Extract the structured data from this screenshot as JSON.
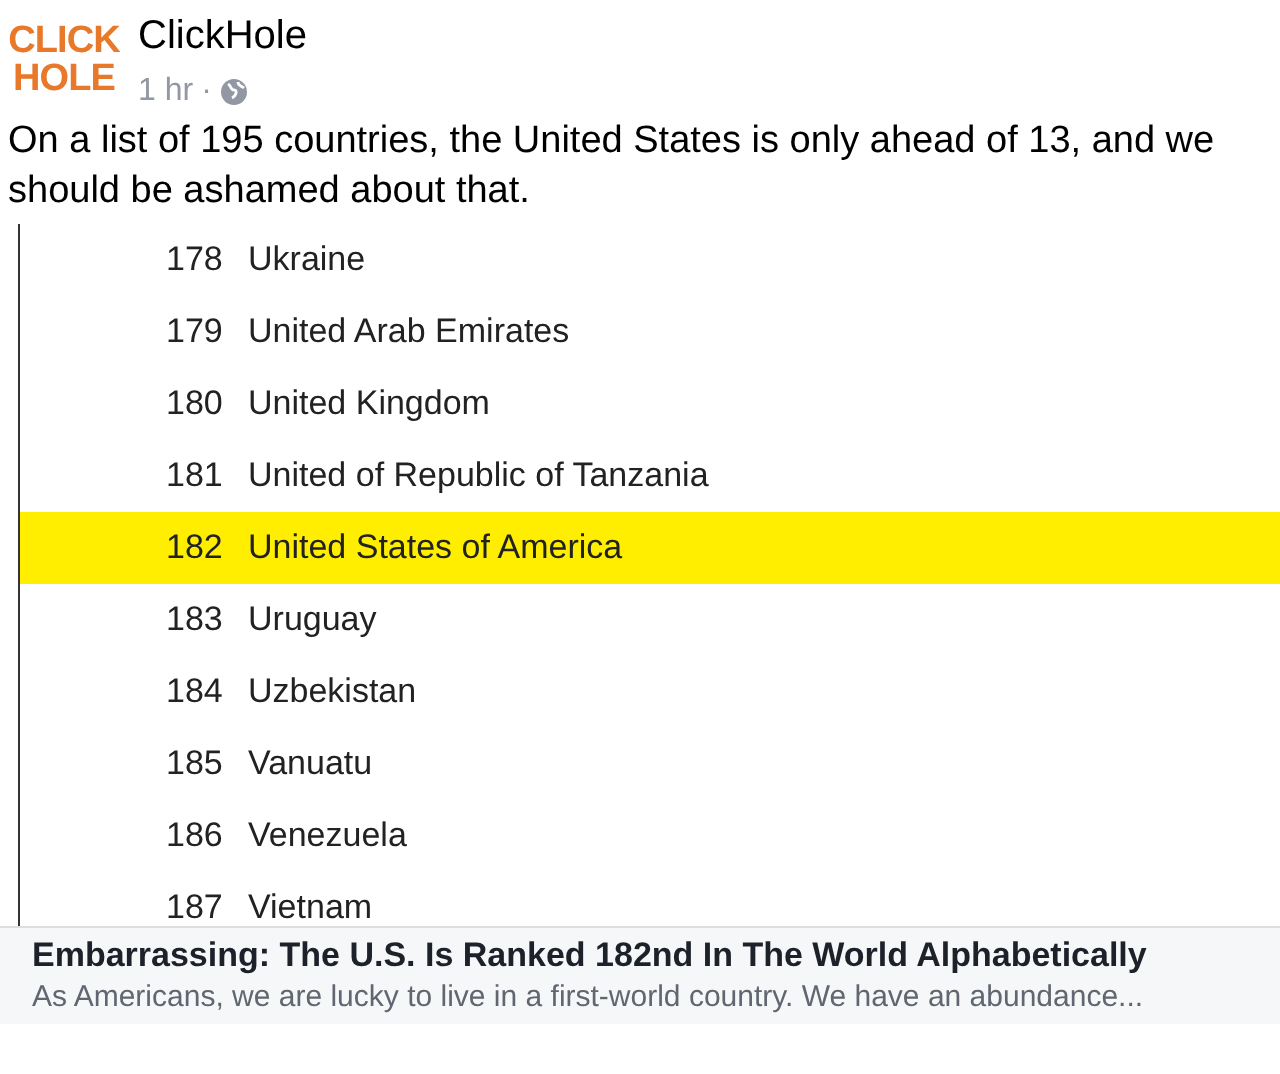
{
  "post": {
    "page_name": "ClickHole",
    "logo_line_1": "CLICK",
    "logo_line_2": "HOLE",
    "time": "1 hr",
    "separator": "·",
    "text": "On a list of 195 countries, the United States is only ahead of 13, and we should be ashamed about that."
  },
  "list": [
    {
      "rank": "178",
      "country": "Ukraine",
      "selected": false
    },
    {
      "rank": "179",
      "country": "United Arab Emirates",
      "selected": false
    },
    {
      "rank": "180",
      "country": "United Kingdom",
      "selected": false
    },
    {
      "rank": "181",
      "country": "United of Republic of Tanzania",
      "selected": false
    },
    {
      "rank": "182",
      "country": "United States of America",
      "selected": true
    },
    {
      "rank": "183",
      "country": "Uruguay",
      "selected": false
    },
    {
      "rank": "184",
      "country": "Uzbekistan",
      "selected": false
    },
    {
      "rank": "185",
      "country": "Vanuatu",
      "selected": false
    },
    {
      "rank": "186",
      "country": "Venezuela",
      "selected": false
    },
    {
      "rank": "187",
      "country": "Vietnam",
      "selected": false
    }
  ],
  "link_preview": {
    "title": "Embarrassing: The U.S. Is Ranked 182nd In The World Alphabetically",
    "description": "As Americans, we are lucky to live in a first-world country. We have an abundance..."
  }
}
